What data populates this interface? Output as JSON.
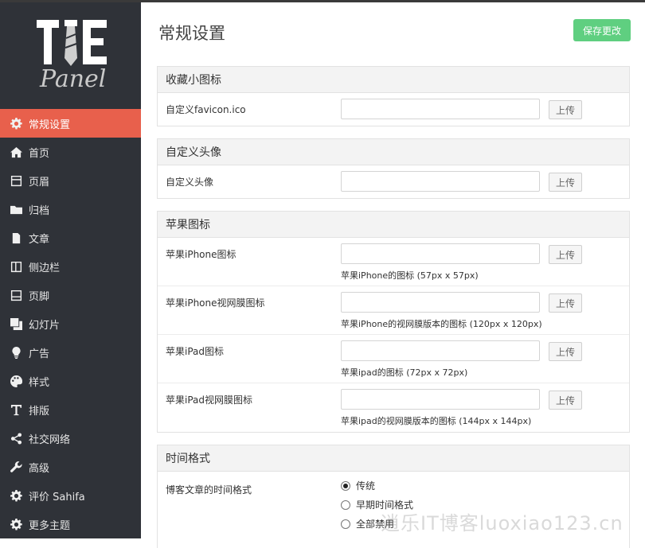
{
  "logo": {
    "line1": "TIE",
    "line2": "Panel"
  },
  "sidebar": {
    "items": [
      {
        "label": "常规设置",
        "icon": "gear-icon",
        "active": true
      },
      {
        "label": "首页",
        "icon": "home-icon"
      },
      {
        "label": "页眉",
        "icon": "header-icon"
      },
      {
        "label": "归档",
        "icon": "folder-icon"
      },
      {
        "label": "文章",
        "icon": "document-icon"
      },
      {
        "label": "侧边栏",
        "icon": "sidebar-icon"
      },
      {
        "label": "页脚",
        "icon": "footer-icon"
      },
      {
        "label": "幻灯片",
        "icon": "slides-icon"
      },
      {
        "label": "广告",
        "icon": "lightbulb-icon"
      },
      {
        "label": "样式",
        "icon": "palette-icon"
      },
      {
        "label": "排版",
        "icon": "typography-icon"
      },
      {
        "label": "社交网络",
        "icon": "share-icon"
      },
      {
        "label": "高级",
        "icon": "wrench-icon"
      },
      {
        "label": "评价 Sahifa",
        "icon": "gear-icon"
      },
      {
        "label": "更多主题",
        "icon": "gear-icon"
      }
    ]
  },
  "header": {
    "title": "常规设置",
    "save_label": "保存更改"
  },
  "sections": {
    "favicon": {
      "title": "收藏小图标",
      "rows": [
        {
          "label": "自定义favicon.ico",
          "value": "",
          "upload": "上传"
        }
      ]
    },
    "avatar": {
      "title": "自定义头像",
      "rows": [
        {
          "label": "自定义头像",
          "value": "",
          "upload": "上传"
        }
      ]
    },
    "apple": {
      "title": "苹果图标",
      "rows": [
        {
          "label": "苹果iPhone图标",
          "value": "",
          "upload": "上传",
          "hint": "苹果iPhone的图标 (57px x 57px)"
        },
        {
          "label": "苹果iPhone视网膜图标",
          "value": "",
          "upload": "上传",
          "hint": "苹果iPhone的视网膜版本的图标 (120px x 120px)"
        },
        {
          "label": "苹果iPad图标",
          "value": "",
          "upload": "上传",
          "hint": "苹果ipad的图标 (72px x 72px)"
        },
        {
          "label": "苹果iPad视网膜图标",
          "value": "",
          "upload": "上传",
          "hint": "苹果ipad的视网膜版本的图标 (144px x 144px)"
        }
      ]
    },
    "time": {
      "title": "时间格式",
      "label": "博客文章的时间格式",
      "options": [
        {
          "label": "传统",
          "checked": true
        },
        {
          "label": "早期时间格式",
          "checked": false
        },
        {
          "label": "全部禁用",
          "checked": false
        }
      ]
    }
  },
  "watermark": "逍乐IT博客luoxiao123.cn",
  "colors": {
    "sidebar_bg": "#2f3238",
    "active": "#e8604c",
    "save": "#5fcf80"
  }
}
